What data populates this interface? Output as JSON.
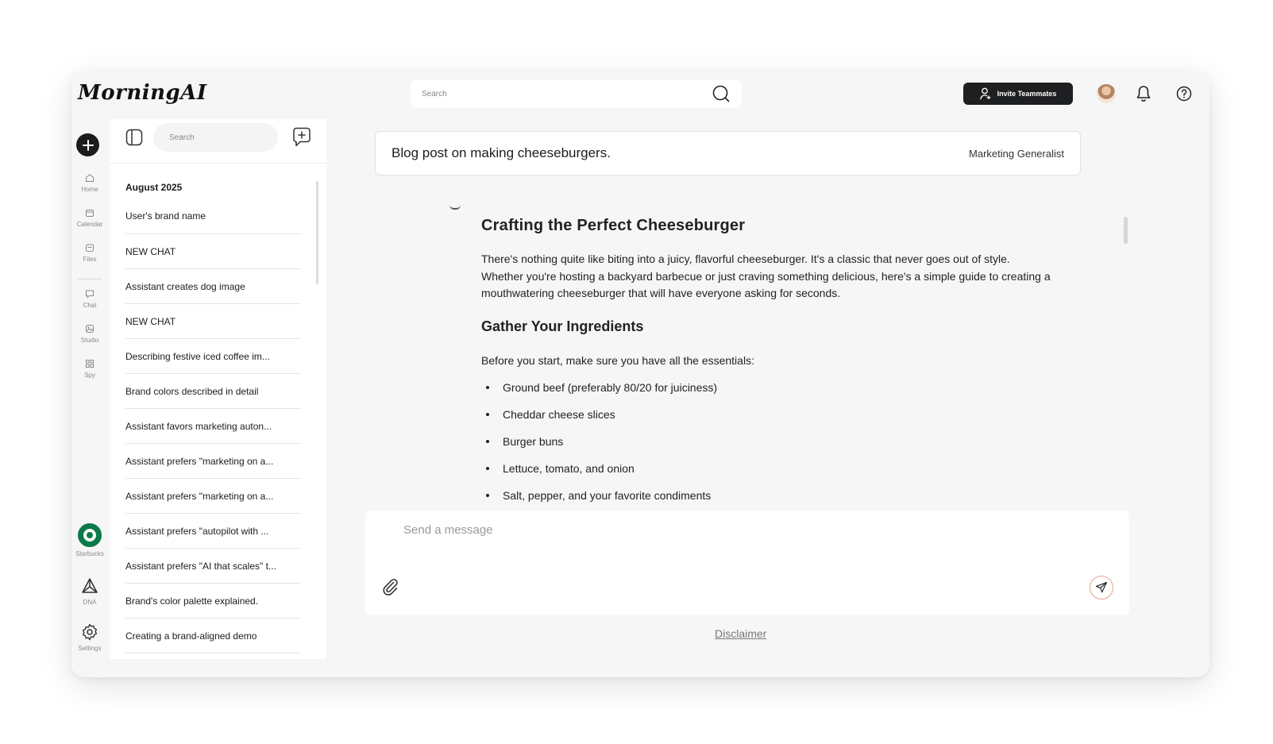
{
  "app": {
    "logo": "MorningAI"
  },
  "topbar": {
    "search_placeholder": "Search",
    "invite_label": "Invite Teammates"
  },
  "rail": {
    "items": [
      {
        "label": "Home",
        "icon": "home-icon"
      },
      {
        "label": "Calendar",
        "icon": "calendar-icon"
      },
      {
        "label": "Files",
        "icon": "files-icon"
      },
      {
        "label": "Chat",
        "icon": "chat-icon"
      },
      {
        "label": "Studio",
        "icon": "studio-icon"
      },
      {
        "label": "Spy",
        "icon": "spy-icon"
      }
    ],
    "bottom": [
      {
        "label": "Starbucks",
        "icon": "starbucks-logo"
      },
      {
        "label": "DNA",
        "icon": "dna-icon"
      },
      {
        "label": "Settings",
        "icon": "gear-icon"
      }
    ]
  },
  "history": {
    "search_placeholder": "Search",
    "month": "August 2025",
    "items": [
      "User's brand name",
      "NEW CHAT",
      "Assistant creates dog image",
      "NEW CHAT",
      "Describing festive iced coffee im...",
      "Brand colors described in detail",
      "Assistant favors marketing auton...",
      "Assistant prefers \"marketing on a...",
      "Assistant prefers \"marketing on a...",
      "Assistant prefers \"autopilot with ...",
      "Assistant prefers \"AI that scales\" t...",
      "Brand's color palette explained.",
      "Creating a brand-aligned demo"
    ]
  },
  "main": {
    "topic_title": "Blog post on making cheeseburgers.",
    "topic_role": "Marketing Generalist",
    "article": {
      "title": "Crafting the Perfect Cheeseburger",
      "intro": "There's nothing quite like biting into a juicy, flavorful cheeseburger. It's a classic that never goes out of style. Whether you're hosting a backyard barbecue or just craving something delicious, here's a simple guide to creating a mouthwatering cheeseburger that will have everyone asking for seconds.",
      "section_title": "Gather Your Ingredients",
      "section_intro": "Before you start, make sure you have all the essentials:",
      "ingredients": [
        "Ground beef (preferably 80/20 for juiciness)",
        "Cheddar cheese slices",
        "Burger buns",
        "Lettuce, tomato, and onion",
        "Salt, pepper, and your favorite condiments"
      ]
    },
    "composer_placeholder": "Send a message",
    "disclaimer": "Disclaimer"
  },
  "colors": {
    "primary_dark": "#1e1f21",
    "send_accent": "#e9a28f",
    "starbucks_green": "#0b7a4b"
  }
}
